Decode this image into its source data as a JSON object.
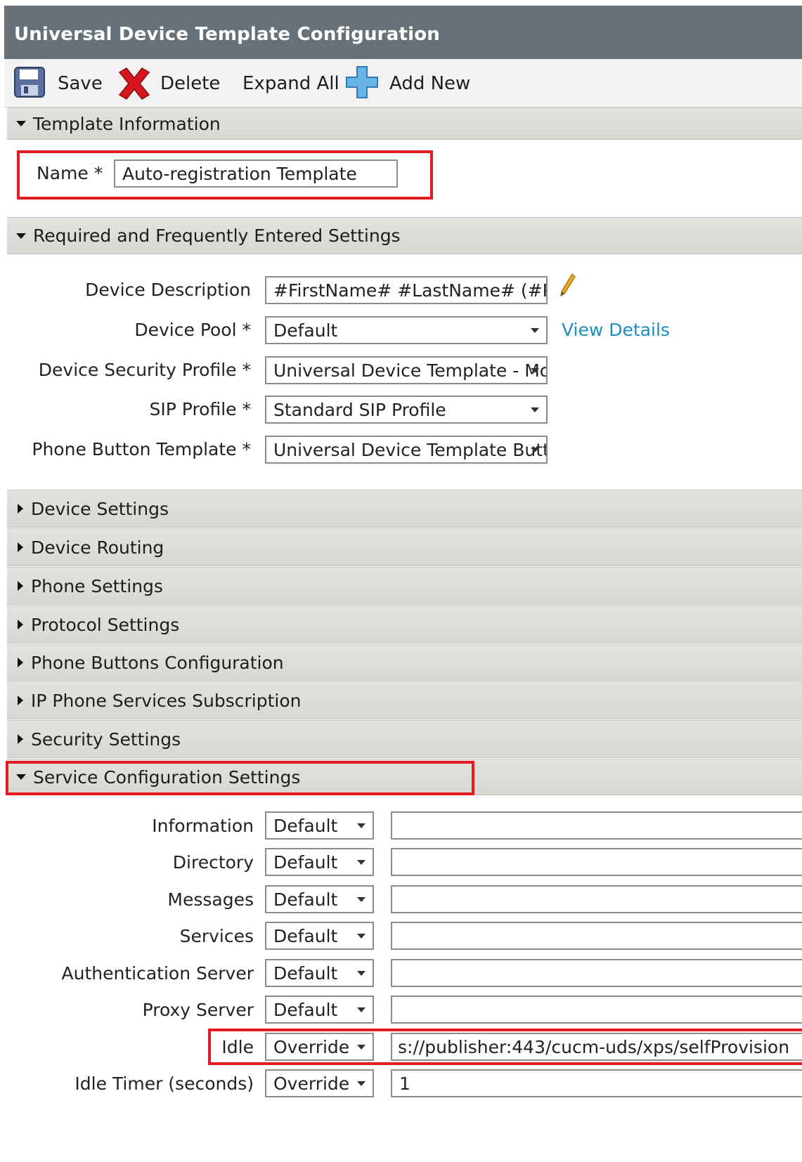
{
  "window": {
    "title": "Universal Device Template Configuration"
  },
  "toolbar": {
    "save_label": "Save",
    "delete_label": "Delete",
    "expand_all_label": "Expand All",
    "add_new_label": "Add New",
    "icons": [
      "save-icon",
      "delete-icon",
      "add-new-icon"
    ]
  },
  "template_info": {
    "header": "Template Information",
    "name_label": "Name *",
    "name_value": "Auto-registration Template"
  },
  "required": {
    "header": "Required and Frequently Entered Settings",
    "device_description_label": "Device Description",
    "device_description_value": "#FirstName# #LastName# (#Prc",
    "device_pool_label": "Device Pool *",
    "device_pool_value": "Default",
    "view_details": "View Details",
    "device_security_profile_label": "Device Security Profile *",
    "device_security_profile_value": "Universal Device Template - Mo",
    "sip_profile_label": "SIP Profile *",
    "sip_profile_value": "Standard SIP Profile",
    "phone_button_template_label": "Phone Button Template *",
    "phone_button_template_value": "Universal Device Template Butt"
  },
  "collapsed_sections": [
    "Device Settings",
    "Device Routing",
    "Phone Settings",
    "Protocol Settings",
    "Phone Buttons Configuration",
    "IP Phone Services Subscription",
    "Security Settings"
  ],
  "service_config": {
    "header": "Service Configuration Settings",
    "rows": [
      {
        "label": "Information",
        "mode": "Default",
        "value": ""
      },
      {
        "label": "Directory",
        "mode": "Default",
        "value": ""
      },
      {
        "label": "Messages",
        "mode": "Default",
        "value": ""
      },
      {
        "label": "Services",
        "mode": "Default",
        "value": ""
      },
      {
        "label": "Authentication Server",
        "mode": "Default",
        "value": ""
      },
      {
        "label": "Proxy Server",
        "mode": "Default",
        "value": ""
      },
      {
        "label": "Idle",
        "mode": "Override",
        "value": "s://publisher:443/cucm-uds/xps/selfProvision"
      },
      {
        "label": "Idle Timer (seconds)",
        "mode": "Override",
        "value": "1"
      }
    ]
  },
  "colors": {
    "title_bar": "#667179",
    "highlight_box": "#e31b23",
    "link": "#1a8ec4",
    "section_header": "#dddbd6"
  }
}
